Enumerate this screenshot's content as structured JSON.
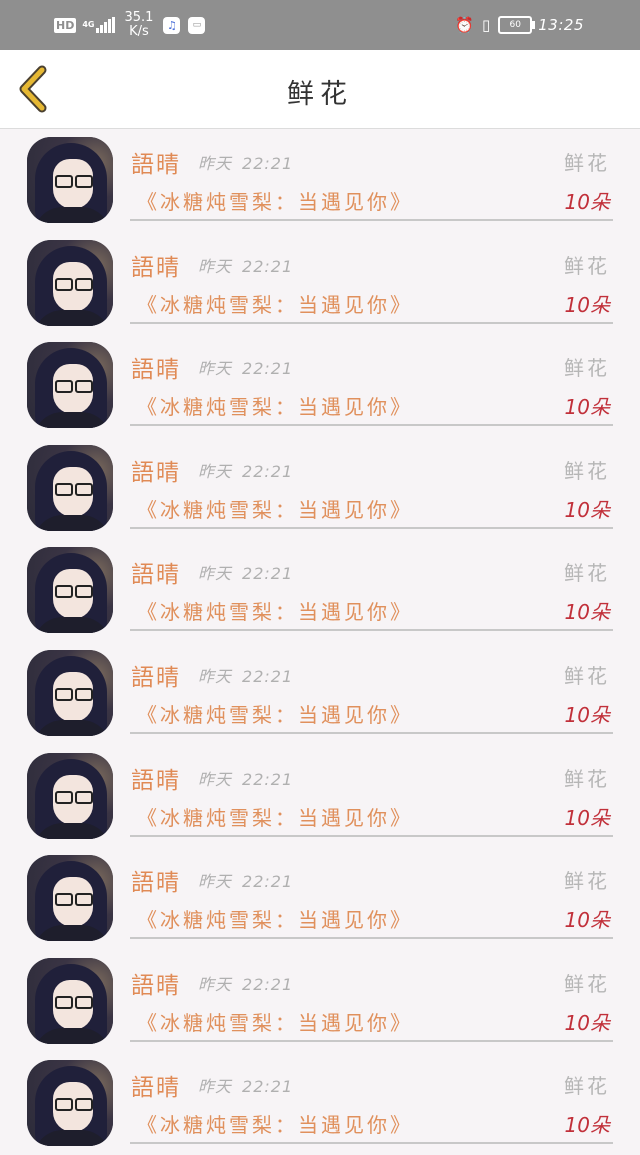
{
  "status_bar": {
    "hd": "HD",
    "network": "4G",
    "speed_value": "35.1",
    "speed_unit": "K/s",
    "battery": "60",
    "time": "13:25"
  },
  "header": {
    "title": "鲜花"
  },
  "list": [
    {
      "name": "語晴",
      "day": "昨天",
      "time": "22:21",
      "gift": "鲜花",
      "song": "《冰糖炖雪梨：当遇见你》",
      "count": "10朵"
    },
    {
      "name": "語晴",
      "day": "昨天",
      "time": "22:21",
      "gift": "鲜花",
      "song": "《冰糖炖雪梨：当遇见你》",
      "count": "10朵"
    },
    {
      "name": "語晴",
      "day": "昨天",
      "time": "22:21",
      "gift": "鲜花",
      "song": "《冰糖炖雪梨：当遇见你》",
      "count": "10朵"
    },
    {
      "name": "語晴",
      "day": "昨天",
      "time": "22:21",
      "gift": "鲜花",
      "song": "《冰糖炖雪梨：当遇见你》",
      "count": "10朵"
    },
    {
      "name": "語晴",
      "day": "昨天",
      "time": "22:21",
      "gift": "鲜花",
      "song": "《冰糖炖雪梨：当遇见你》",
      "count": "10朵"
    },
    {
      "name": "語晴",
      "day": "昨天",
      "time": "22:21",
      "gift": "鲜花",
      "song": "《冰糖炖雪梨：当遇见你》",
      "count": "10朵"
    },
    {
      "name": "語晴",
      "day": "昨天",
      "time": "22:21",
      "gift": "鲜花",
      "song": "《冰糖炖雪梨：当遇见你》",
      "count": "10朵"
    },
    {
      "name": "語晴",
      "day": "昨天",
      "time": "22:21",
      "gift": "鲜花",
      "song": "《冰糖炖雪梨：当遇见你》",
      "count": "10朵"
    },
    {
      "name": "語晴",
      "day": "昨天",
      "time": "22:21",
      "gift": "鲜花",
      "song": "《冰糖炖雪梨：当遇见你》",
      "count": "10朵"
    },
    {
      "name": "語晴",
      "day": "昨天",
      "time": "22:21",
      "gift": "鲜花",
      "song": "《冰糖炖雪梨：当遇见你》",
      "count": "10朵"
    }
  ],
  "colors": {
    "header_bg": "#ffffff",
    "back_icon": "#e6b833",
    "name": "#e08a55",
    "count": "#c1303a"
  },
  "icons": {
    "back": "chevron-left-icon",
    "alarm": "alarm-icon",
    "vibrate": "vibrate-icon"
  }
}
